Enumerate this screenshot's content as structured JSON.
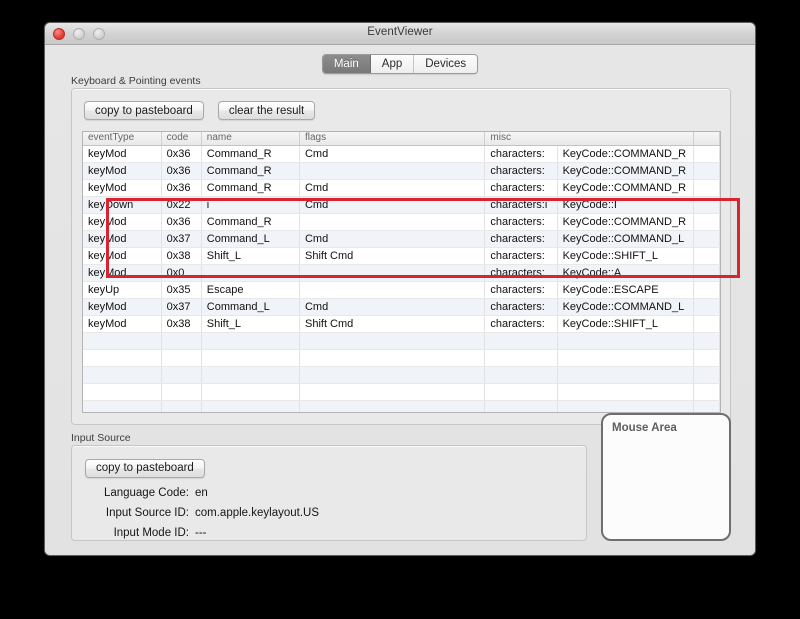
{
  "window": {
    "title": "EventViewer",
    "traffic_lights": [
      "close",
      "minimize",
      "zoom"
    ]
  },
  "tabs": [
    {
      "label": "Main",
      "selected": true
    },
    {
      "label": "App",
      "selected": false
    },
    {
      "label": "Devices",
      "selected": false
    }
  ],
  "keyboard_group": {
    "label": "Keyboard & Pointing events",
    "copy_button": "copy to pasteboard",
    "clear_button": "clear the result",
    "table": {
      "columns": [
        "eventType",
        "code",
        "name",
        "flags",
        "misc",
        "",
        ""
      ],
      "rows": [
        {
          "eventType": "keyMod",
          "code": "0x36",
          "name": "Command_R",
          "flags": "Cmd",
          "misc": "characters:",
          "keycode": "KeyCode::COMMAND_R",
          "tail": "",
          "highlighted": true
        },
        {
          "eventType": "keyMod",
          "code": "0x36",
          "name": "Command_R",
          "flags": "",
          "misc": "characters:",
          "keycode": "KeyCode::COMMAND_R",
          "tail": "",
          "highlighted": true
        },
        {
          "eventType": "keyMod",
          "code": "0x36",
          "name": "Command_R",
          "flags": "Cmd",
          "misc": "characters:",
          "keycode": "KeyCode::COMMAND_R",
          "tail": "",
          "highlighted": true
        },
        {
          "eventType": "keyDown",
          "code": "0x22",
          "name": "i",
          "flags": "Cmd",
          "misc": "characters:i",
          "keycode": "KeyCode::I",
          "tail": "",
          "highlighted": true
        },
        {
          "eventType": "keyMod",
          "code": "0x36",
          "name": "Command_R",
          "flags": "",
          "misc": "characters:",
          "keycode": "KeyCode::COMMAND_R",
          "tail": "",
          "highlighted": true
        },
        {
          "eventType": "keyMod",
          "code": "0x37",
          "name": "Command_L",
          "flags": "Cmd",
          "misc": "characters:",
          "keycode": "KeyCode::COMMAND_L",
          "tail": "",
          "highlighted": false
        },
        {
          "eventType": "keyMod",
          "code": "0x38",
          "name": "Shift_L",
          "flags": "Shift Cmd",
          "misc": "characters:",
          "keycode": "KeyCode::SHIFT_L",
          "tail": "",
          "highlighted": false
        },
        {
          "eventType": "keyMod",
          "code": "0x0",
          "name": "",
          "flags": "",
          "misc": "characters:",
          "keycode": "KeyCode::A",
          "tail": "",
          "highlighted": false
        },
        {
          "eventType": "keyUp",
          "code": "0x35",
          "name": "Escape",
          "flags": "",
          "misc": "characters:",
          "keycode": "KeyCode::ESCAPE",
          "tail": "",
          "highlighted": false
        },
        {
          "eventType": "keyMod",
          "code": "0x37",
          "name": "Command_L",
          "flags": "Cmd",
          "misc": "characters:",
          "keycode": "KeyCode::COMMAND_L",
          "tail": "",
          "highlighted": false
        },
        {
          "eventType": "keyMod",
          "code": "0x38",
          "name": "Shift_L",
          "flags": "Shift Cmd",
          "misc": "characters:",
          "keycode": "KeyCode::SHIFT_L",
          "tail": "",
          "highlighted": false
        }
      ],
      "empty_row_count": 7
    },
    "highlight_color": "#d9232e"
  },
  "input_source_group": {
    "label": "Input Source",
    "copy_button": "copy to pasteboard",
    "fields": [
      {
        "label": "Language Code:",
        "value": "en"
      },
      {
        "label": "Input Source ID:",
        "value": "com.apple.keylayout.US"
      },
      {
        "label": "Input Mode ID:",
        "value": "---"
      }
    ]
  },
  "mouse_area": {
    "label": "Mouse Area"
  }
}
